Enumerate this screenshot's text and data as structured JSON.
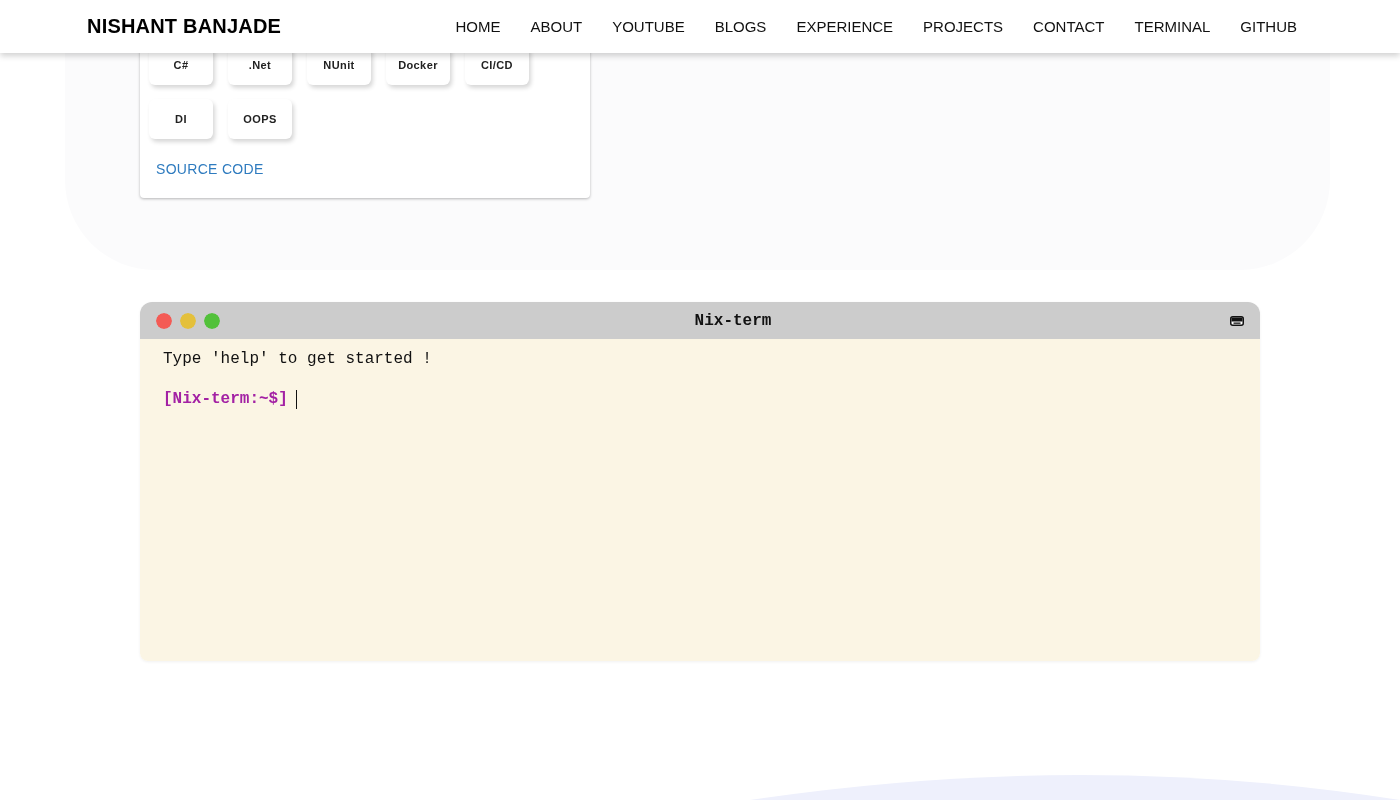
{
  "header": {
    "logo": "NISHANT BANJADE",
    "nav": [
      "HOME",
      "ABOUT",
      "YOUTUBE",
      "BLOGS",
      "EXPERIENCE",
      "PROJECTS",
      "CONTACT",
      "TERMINAL",
      "GITHUB"
    ]
  },
  "project_card": {
    "tags": [
      "C#",
      ".Net",
      "NUnit",
      "Docker",
      "CI/CD",
      "DI",
      "OOPS"
    ],
    "link": "SOURCE CODE"
  },
  "terminal": {
    "title": "Nix-term",
    "lines": [
      "Type 'help' to get started !"
    ],
    "prompt": "[Nix-term:~$]"
  }
}
